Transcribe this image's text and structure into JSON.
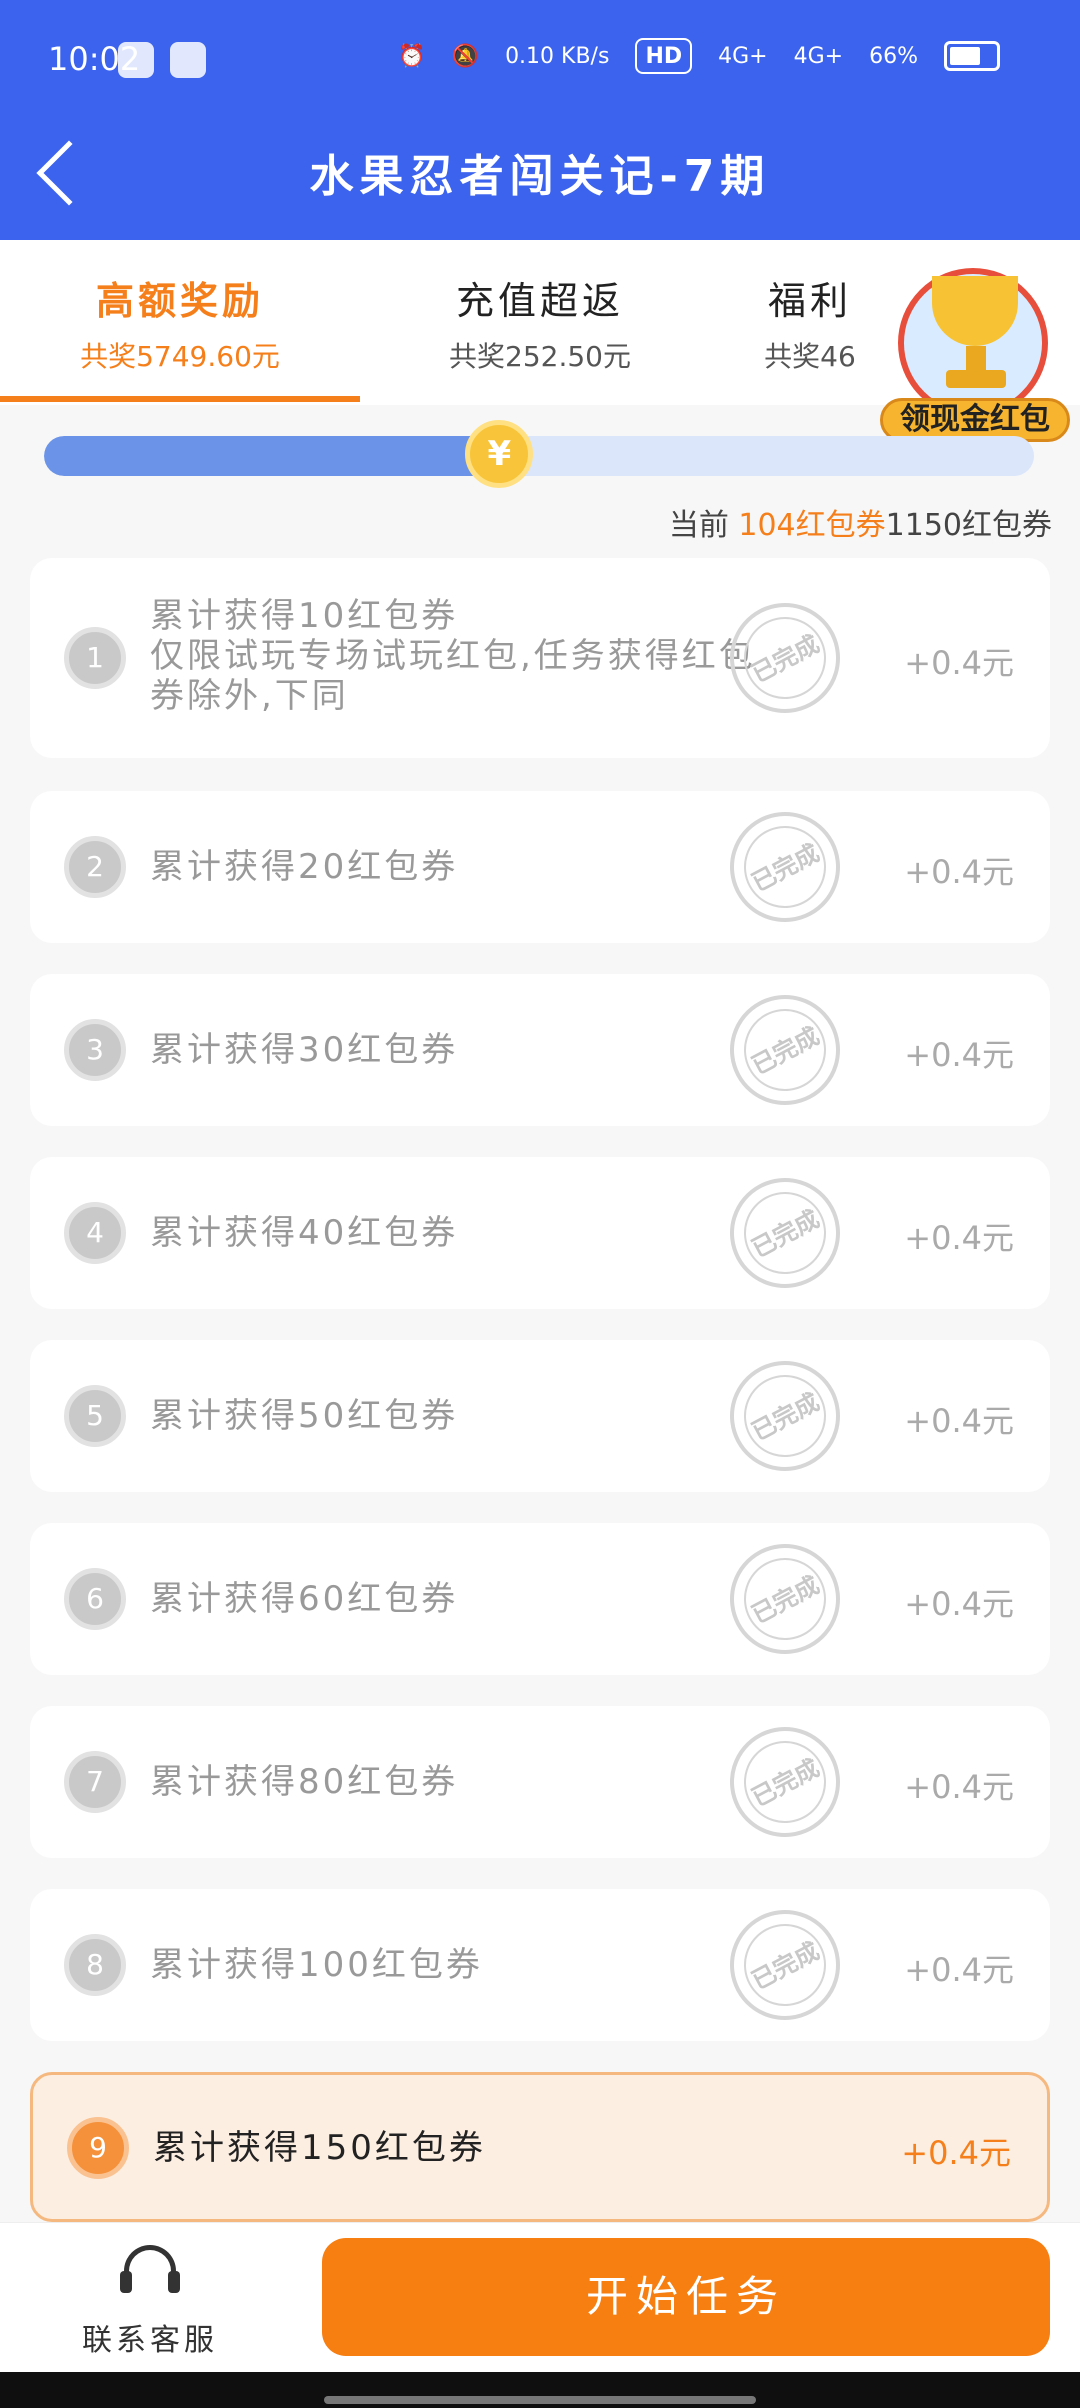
{
  "status_bar": {
    "time": "10:02",
    "net_speed": "0.10 KB/s",
    "hd_label": "HD",
    "signal_1": "4G+",
    "signal_2": "4G+",
    "battery": "66%"
  },
  "header": {
    "title": "水果忍者闯关记-7期"
  },
  "tabs": [
    {
      "label": "高额奖励",
      "sub": "共奖5749.60元",
      "active": true
    },
    {
      "label": "充值超返",
      "sub": "共奖252.50元",
      "active": false
    },
    {
      "label": "福利",
      "sub": "共奖46",
      "active": false
    }
  ],
  "promo": {
    "label": "领现金红包"
  },
  "progress": {
    "fraction": 0.46,
    "coin_symbol": "¥",
    "prefix": "当前",
    "current": "104红包券",
    "target": "1150红包券"
  },
  "tasks": [
    {
      "num": "1",
      "text": "累计获得10红包券",
      "sub": "仅限试玩专场试玩红包,任务获得红包券除外,下同",
      "reward": "+0.4元",
      "status": "已完成"
    },
    {
      "num": "2",
      "text": "累计获得20红包券",
      "reward": "+0.4元",
      "status": "已完成"
    },
    {
      "num": "3",
      "text": "累计获得30红包券",
      "reward": "+0.4元",
      "status": "已完成"
    },
    {
      "num": "4",
      "text": "累计获得40红包券",
      "reward": "+0.4元",
      "status": "已完成"
    },
    {
      "num": "5",
      "text": "累计获得50红包券",
      "reward": "+0.4元",
      "status": "已完成"
    },
    {
      "num": "6",
      "text": "累计获得60红包券",
      "reward": "+0.4元",
      "status": "已完成"
    },
    {
      "num": "7",
      "text": "累计获得80红包券",
      "reward": "+0.4元",
      "status": "已完成"
    },
    {
      "num": "8",
      "text": "累计获得100红包券",
      "reward": "+0.4元",
      "status": "已完成"
    },
    {
      "num": "9",
      "text": "累计获得150红包券",
      "reward": "+0.4元",
      "status": ""
    }
  ],
  "bottom": {
    "service_label": "联系客服",
    "start_label": "开始任务"
  },
  "colors": {
    "header_blue": "#3b63ee",
    "accent_orange": "#f57f1a",
    "progress_fill": "#6b94e8"
  }
}
